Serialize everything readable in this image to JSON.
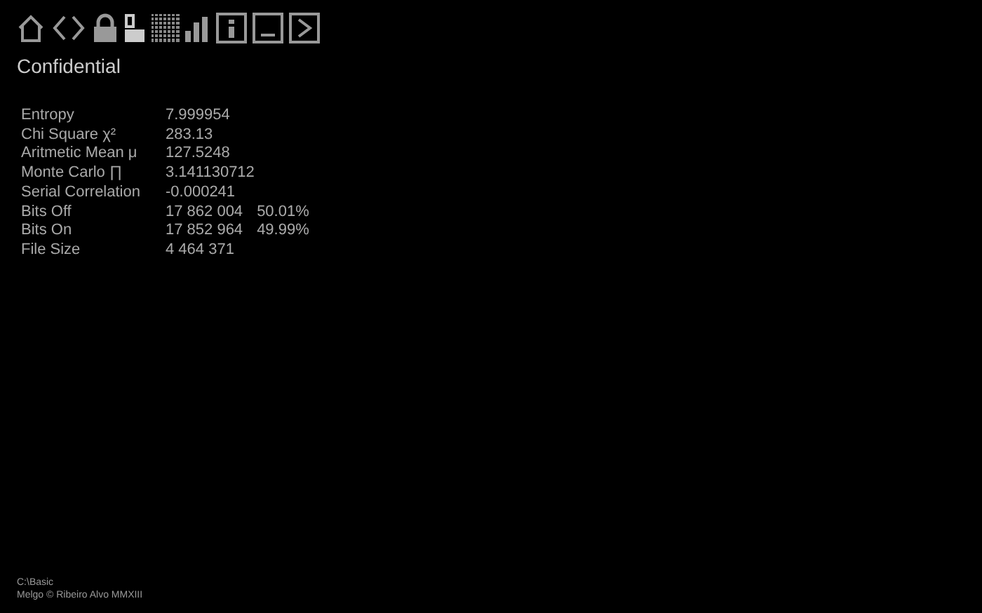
{
  "title": "Confidential",
  "stats": [
    {
      "label": "Entropy",
      "value": "7.999954"
    },
    {
      "label": "Chi Square χ²",
      "value": "283.13"
    },
    {
      "label": "Aritmetic Mean μ",
      "value": "127.5248"
    },
    {
      "label": "Monte Carlo ∏",
      "value": "3.141130712"
    },
    {
      "label": "Serial Correlation",
      "value": "-0.000241"
    },
    {
      "label": "Bits Off",
      "value": "17 862 004",
      "percent": "50.01%"
    },
    {
      "label": "Bits On",
      "value": "17 852 964",
      "percent": "49.99%"
    },
    {
      "label": "File Size",
      "value": "4 464 371"
    }
  ],
  "footer": {
    "path": "C:\\Basic",
    "credit": "Melgo © Ribeiro Alvo MMXIII"
  }
}
